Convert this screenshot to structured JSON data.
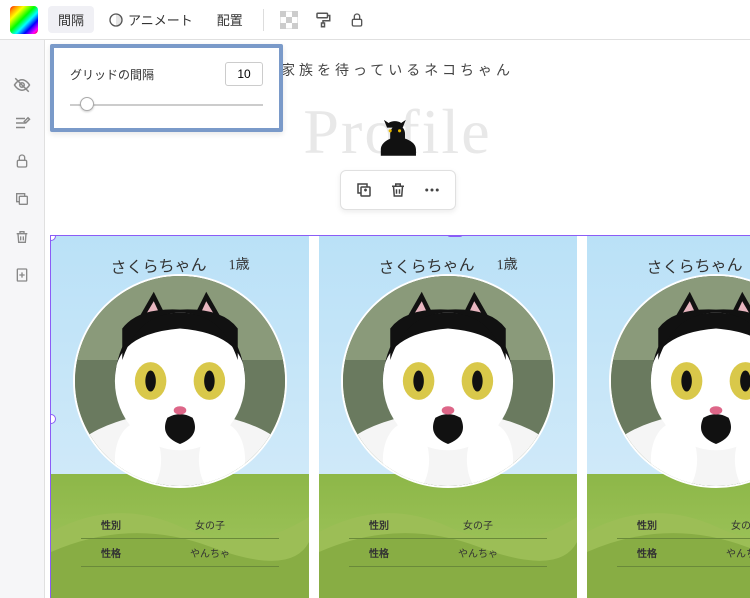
{
  "toolbar": {
    "spacing": "間隔",
    "animate": "アニメート",
    "position": "配置"
  },
  "popover": {
    "label": "グリッドの間隔",
    "value": "10"
  },
  "header": {
    "title": "家族を待っているネコちゃん",
    "script": "Profile"
  },
  "card": {
    "name": "さくらちゃん",
    "age": "1歳",
    "rows": [
      {
        "k": "性別",
        "v": "女の子"
      },
      {
        "k": "性格",
        "v": "やんちゃ"
      }
    ]
  }
}
